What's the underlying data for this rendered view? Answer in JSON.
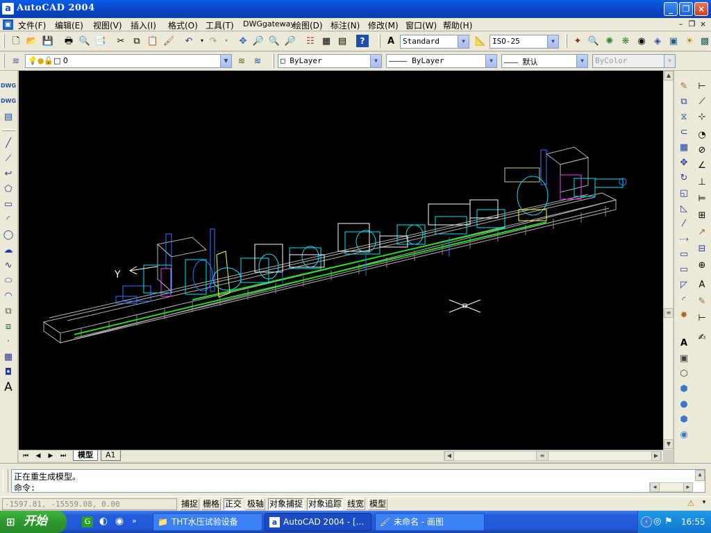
{
  "window": {
    "title": "AutoCAD 2004",
    "app_icon": "a",
    "minimize": "_",
    "restore": "❐",
    "close": "×"
  },
  "menubar": {
    "items": [
      "文件(F)",
      "编辑(E)",
      "视图(V)",
      "插入(I)",
      "格式(O)",
      "工具(T)",
      "DWGgateway",
      "绘图(D)",
      "标注(N)",
      "修改(M)",
      "窗口(W)",
      "帮助(H)"
    ],
    "doc_minimize": "–",
    "doc_restore": "❐",
    "doc_close": "×"
  },
  "toolbar": {
    "text_style": "Standard",
    "dim_style": "ISO-25"
  },
  "properties": {
    "layer": "0",
    "color": "ByLayer",
    "linetype": "ByLayer",
    "lineweight": "默认",
    "plotstyle": "ByColor"
  },
  "drawing": {
    "ucs_y_label": "Y"
  },
  "layout_tabs": [
    "模型",
    "A1"
  ],
  "command": {
    "history": "正在重生成模型。",
    "prompt": "命令:"
  },
  "status": {
    "coords": "-1597.81, -15559.08, 0.00",
    "toggles": [
      {
        "label": "捕捉",
        "on": false
      },
      {
        "label": "栅格",
        "on": false
      },
      {
        "label": "正交",
        "on": true
      },
      {
        "label": "极轴",
        "on": false
      },
      {
        "label": "对象捕捉",
        "on": true
      },
      {
        "label": "对象追踪",
        "on": true
      },
      {
        "label": "线宽",
        "on": false
      },
      {
        "label": "模型",
        "on": false
      }
    ]
  },
  "taskbar": {
    "start": "开始",
    "tasks": [
      "THT水压试验设备",
      "AutoCAD 2004 - [...",
      "未命名 - 画图"
    ],
    "clock": "16:55"
  },
  "colors": {
    "title_blue": "#0845c2",
    "canvas": "#000000",
    "taskbar_blue": "#245edb",
    "start_green": "#2f9a2f"
  }
}
